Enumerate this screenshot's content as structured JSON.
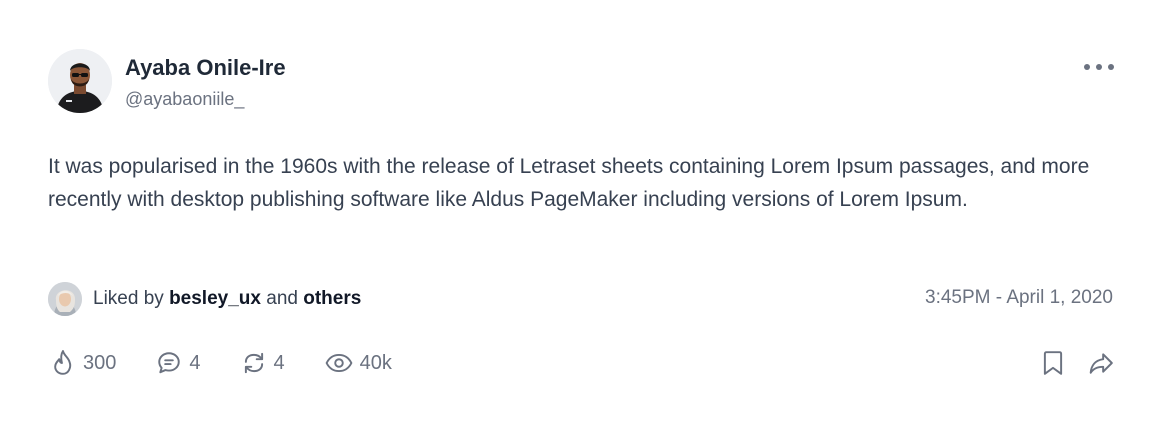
{
  "post": {
    "author": {
      "name": "Ayaba Onile-Ire",
      "handle": "@ayabaoniile_",
      "avatar_icon": "profile-photo"
    },
    "menu_icon": "more-horizontal-icon",
    "text": "It was popularised in the 1960s with the release of Letraset sheets containing Lorem Ipsum passages, and more recently with desktop publishing software like Aldus PageMaker including versions of Lorem Ipsum.",
    "likes": {
      "prefix": "Liked by",
      "user": "besley_ux",
      "conjunction": "and",
      "others": "others"
    },
    "timestamp": "3:45PM - April 1, 2020",
    "actions": {
      "flame": {
        "icon": "flame-icon",
        "count": "300"
      },
      "comments": {
        "icon": "comment-icon",
        "count": "4"
      },
      "reposts": {
        "icon": "repost-icon",
        "count": "4"
      },
      "views": {
        "icon": "eye-icon",
        "count": "40k"
      }
    },
    "bookmark_icon": "bookmark-icon",
    "share_icon": "share-icon"
  },
  "colors": {
    "text": "#374151",
    "muted": "#6b7280",
    "strong": "#111827"
  }
}
